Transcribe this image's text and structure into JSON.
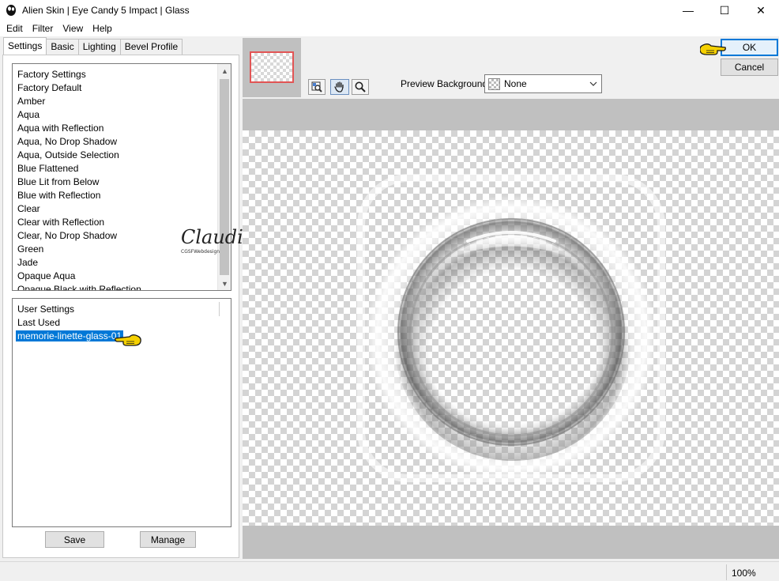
{
  "window": {
    "title": "Alien Skin | Eye Candy 5 Impact | Glass",
    "minimize": "—",
    "maximize": "☐",
    "close": "✕"
  },
  "menu": [
    "Edit",
    "Filter",
    "View",
    "Help"
  ],
  "tabs": [
    "Settings",
    "Basic",
    "Lighting",
    "Bevel Profile"
  ],
  "factory": {
    "header": "Factory Settings",
    "items": [
      "Factory Default",
      "Amber",
      "Aqua",
      "Aqua with Reflection",
      "Aqua, No Drop Shadow",
      "Aqua, Outside Selection",
      "Blue Flattened",
      "Blue Lit from Below",
      "Blue with Reflection",
      "Clear",
      "Clear with Reflection",
      "Clear, No Drop Shadow",
      "Green",
      "Jade",
      "Opaque Aqua",
      "Opaque Black with Reflection"
    ]
  },
  "user": {
    "header": "User Settings",
    "items": [
      "Last Used",
      "memorie-linette-glass-01"
    ],
    "selected_index": 1
  },
  "buttons": {
    "save": "Save",
    "manage": "Manage",
    "ok": "OK",
    "cancel": "Cancel"
  },
  "preview": {
    "label": "Preview Background:",
    "value": "None"
  },
  "watermark": {
    "name": "Claudia",
    "sub": "CGSFWebdesign"
  },
  "status": {
    "zoom": "100%"
  },
  "colors": {
    "selection": "#0078d7",
    "hand": "#f5d000",
    "thumb_border": "#e25555"
  },
  "icons": [
    "app-icon",
    "preview-tool-icon",
    "hand-tool-icon",
    "zoom-tool-icon",
    "hand-pointer-icon",
    "chevron-down-icon"
  ]
}
